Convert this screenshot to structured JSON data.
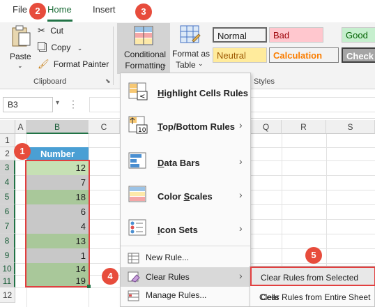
{
  "ribbon_tabs": [
    "File",
    "Home",
    "Insert"
  ],
  "clipboard": {
    "paste_label": "Paste",
    "cut_label": "Cut",
    "copy_label": "Copy",
    "format_painter_label": "Format Painter",
    "group_label": "Clipboard"
  },
  "conditional_formatting": {
    "line1": "Conditional",
    "line2": "Formatting"
  },
  "format_as_table": {
    "line1": "Format as",
    "line2": "Table"
  },
  "styles": {
    "group_label": "Styles",
    "items": [
      {
        "label": "Normal",
        "bg": "#ffffff",
        "color": "#000000"
      },
      {
        "label": "Bad",
        "bg": "#ffc7ce",
        "color": "#9c0006"
      },
      {
        "label": "Good",
        "bg": "#c6efce",
        "color": "#006100"
      },
      {
        "label": "Neutral",
        "bg": "#ffeb9c",
        "color": "#9c5700"
      },
      {
        "label": "Calculation",
        "bg": "#f2f2f2",
        "color": "#fa7d00"
      },
      {
        "label": "Check C",
        "bg": "#a5a5a5",
        "color": "#ffffff"
      }
    ]
  },
  "name_box": "B3",
  "columns": [
    "A",
    "B",
    "C",
    "Q",
    "R",
    "S"
  ],
  "rows": [
    "1",
    "2",
    "3",
    "4",
    "5",
    "6",
    "7",
    "8",
    "9",
    "10",
    "11",
    "12"
  ],
  "table": {
    "header": "Number",
    "values": [
      "12",
      "7",
      "18",
      "6",
      "4",
      "13",
      "1",
      "14",
      "19"
    ]
  },
  "menu": {
    "items": [
      {
        "label": "Highlight Cells Rules",
        "accel": "H"
      },
      {
        "label": "Top/Bottom Rules",
        "accel": "T"
      },
      {
        "label": "Data Bars",
        "accel": "D"
      },
      {
        "label": "Color Scales",
        "accel": "S"
      },
      {
        "label": "Icon Sets",
        "accel": "I"
      }
    ],
    "new_rule": "New Rule...",
    "clear_rules": "Clear Rules",
    "manage_rules": "Manage Rules..."
  },
  "submenu": {
    "selected_cells": "Clear Rules from Selected Cells",
    "entire_sheet": "Clear Rules from Entire Sheet"
  },
  "badges": [
    "1",
    "2",
    "3",
    "4",
    "5"
  ],
  "colors": {
    "accent_green": "#217346",
    "badge_red": "#e74c3c",
    "header_blue": "#4a9fd4",
    "band_green": "#a9c89a",
    "band_gray": "#c8c8c8"
  }
}
